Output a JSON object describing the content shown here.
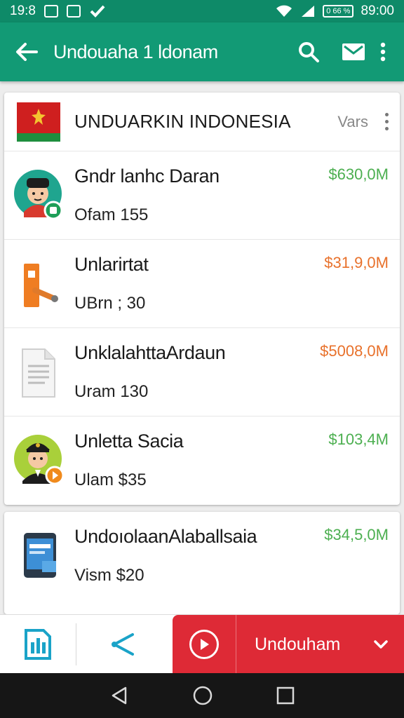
{
  "status_bar": {
    "time_left": "19:8",
    "battery_text": "0 66 %",
    "time_right": "89:00"
  },
  "app_bar": {
    "title": "Undouaha 1 ldonam",
    "back_icon": "arrow-left-icon",
    "search_icon": "search-icon",
    "mail_icon": "mail-icon",
    "more_icon": "more-vert-icon"
  },
  "card": {
    "title": "UNDUARKIN INDONESIA",
    "filter": "Vars",
    "items": [
      {
        "name": "Gndr lanhc Daran",
        "sub": "Ofam 155",
        "amount": "$630,0M",
        "amount_color": "#4caf50",
        "avatar": "man-avatar-icon"
      },
      {
        "name": "Unlarirtat",
        "sub": "UBrn ; 30",
        "amount": "$31,9,0M",
        "amount_color": "#e8712b",
        "avatar": "gate-icon"
      },
      {
        "name": "UnklalahttaArdaun",
        "sub": "Uram 130",
        "amount": "$5008,0M",
        "amount_color": "#e8712b",
        "avatar": "document-icon"
      },
      {
        "name": "Unletta Sacia",
        "sub": "Ulam $35",
        "amount": "$103,4M",
        "amount_color": "#4caf50",
        "avatar": "officer-avatar-icon"
      }
    ]
  },
  "card2": {
    "name": "UndoıolaanAlaballsaia",
    "sub": "Vism $20",
    "amount": "$34,5,0M",
    "amount_color": "#4caf50",
    "avatar": "tablet-icon"
  },
  "action_bar": {
    "red_label": "Undouham"
  }
}
